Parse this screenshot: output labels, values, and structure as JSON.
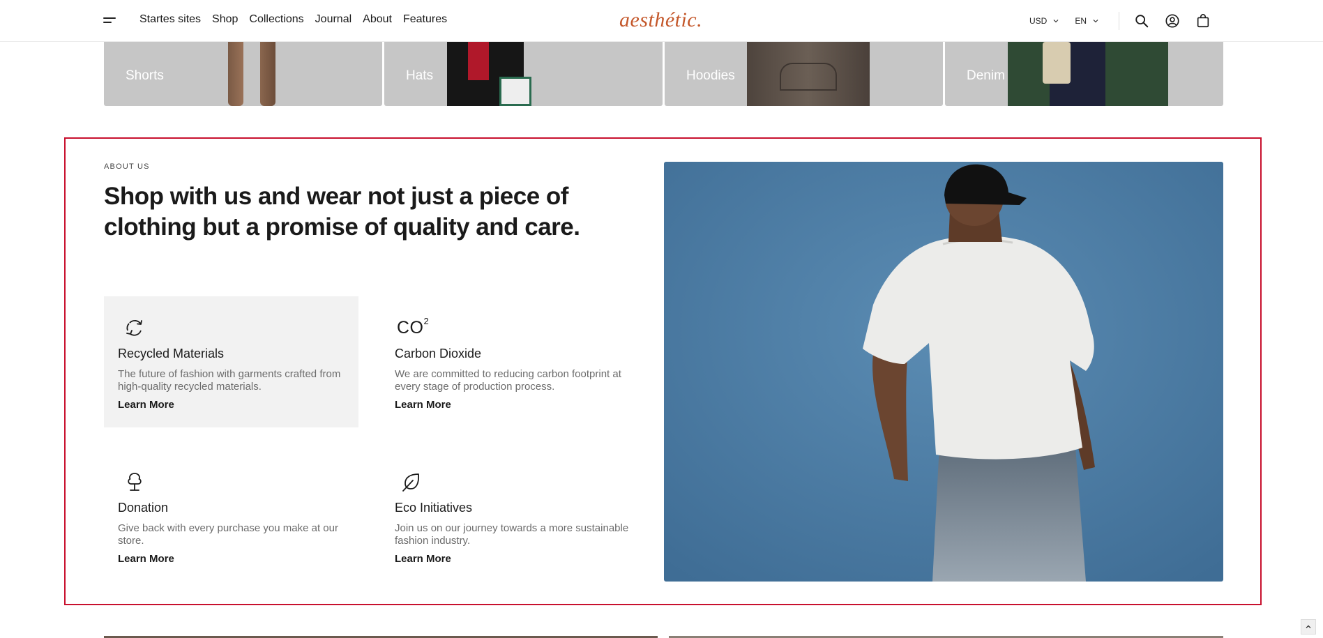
{
  "header": {
    "nav": [
      "Startes sites",
      "Shop",
      "Collections",
      "Journal",
      "About",
      "Features"
    ],
    "logo": "aesthétic.",
    "currency": "USD",
    "language": "EN",
    "icons": [
      "menu-icon",
      "search-icon",
      "account-icon",
      "bag-icon"
    ]
  },
  "categories": [
    {
      "label": "Shorts"
    },
    {
      "label": "Hats"
    },
    {
      "label": "Hoodies"
    },
    {
      "label": "Denim"
    }
  ],
  "about": {
    "eyebrow": "ABOUT US",
    "headline": "Shop with us and wear not just a piece of clothing but a promise of quality and care.",
    "features": [
      {
        "title": "Recycled Materials",
        "desc": "The future of fashion with garments crafted from high-quality recycled materials.",
        "link": "Learn More",
        "icon": "recycle-icon"
      },
      {
        "title": "Carbon Dioxide",
        "icon_text": "CO",
        "icon_sup": "2",
        "desc": "We are committed to reducing carbon footprint at every stage of production process.",
        "link": "Learn More",
        "icon": "co2-icon"
      },
      {
        "title": "Donation",
        "desc": "Give back with every purchase you make at our store.",
        "link": "Learn More",
        "icon": "tree-icon"
      },
      {
        "title": "Eco Initiatives",
        "desc": "Join us on our journey towards a more sustainable fashion industry.",
        "link": "Learn More",
        "icon": "leaf-icon"
      }
    ]
  },
  "colors": {
    "accent": "#c4572a",
    "highlight_border": "#c8102e",
    "photo_bg": "#4f7fa6",
    "tile_bg": "#c6c6c6",
    "card_bg": "#f2f2f2"
  }
}
